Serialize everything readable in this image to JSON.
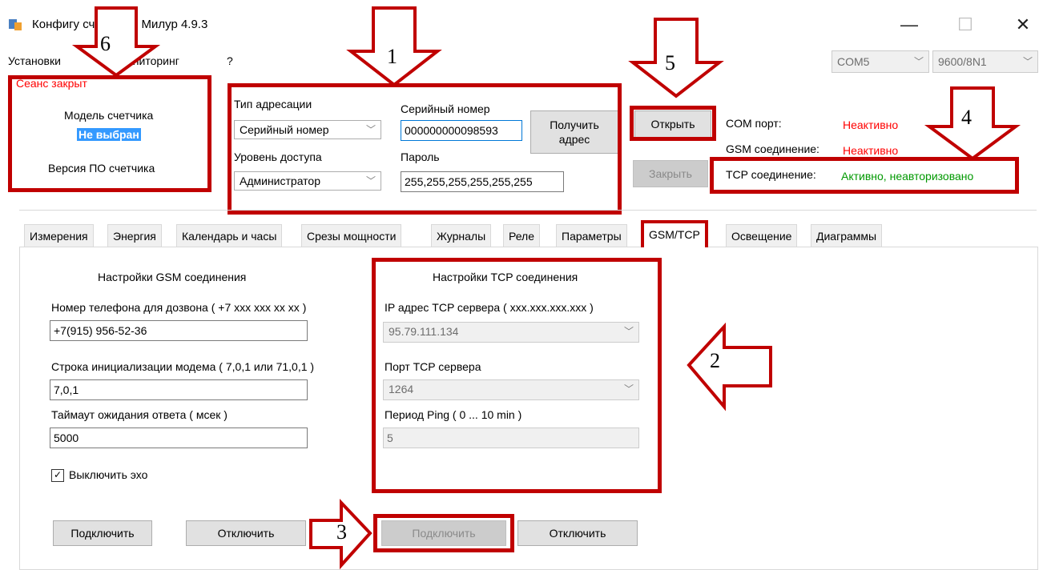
{
  "window": {
    "title": "Конфигуратор счетчиков Милур 4.9.3",
    "title_visible": "Конфигу  счетчиков Милур 4.9.3",
    "minimize": "—",
    "maximize": "☐",
    "close": "✕"
  },
  "menu": {
    "items": [
      "Установки",
      "Мониторинг",
      "?"
    ],
    "visible_1": "Установки",
    "visible_2": "ониторинг",
    "visible_3": "?"
  },
  "port": {
    "com": "COM5",
    "baud": "9600/8N1"
  },
  "session": {
    "status": "Сеанс закрыт",
    "model_label": "Модель счетчика",
    "model_value": "Не выбран",
    "firmware_label": "Версия ПО счетчика"
  },
  "addressing": {
    "type_label": "Тип адресации",
    "type_value": "Серийный номер",
    "access_label": "Уровень доступа",
    "access_value": "Администратор",
    "serial_label": "Серийный номер",
    "serial_value": "000000000098593",
    "password_label": "Пароль",
    "password_value": "255,255,255,255,255,255",
    "get_address_button": "Получить адрес"
  },
  "connection": {
    "open_button": "Открыть",
    "close_button": "Закрыть",
    "com_label": "COM порт:",
    "com_status": "Неактивно",
    "gsm_label": "GSM соединение:",
    "gsm_status": "Неактивно",
    "tcp_label": "TCP соединение:",
    "tcp_status": "Активно, неавторизовано"
  },
  "tabs": [
    "Измерения",
    "Энергия",
    "Календарь и часы",
    "Срезы мощности",
    "Журналы",
    "Реле",
    "Параметры",
    "GSM/TCP",
    "Освещение",
    "Диаграммы"
  ],
  "active_tab": "GSM/TCP",
  "gsm": {
    "heading": "Настройки GSM соединения",
    "phone_label": "Номер телефона для дозвона ( +7 xxx xxx xx xx )",
    "phone_value": "+7(915) 956-52-36",
    "init_label": "Строка инициализации модема ( 7,0,1 или 71,0,1 )",
    "init_value": "7,0,1",
    "timeout_label": "Таймаут ожидания ответа ( мсек )",
    "timeout_value": "5000",
    "echo_label": "Выключить эхо",
    "echo_checked": true,
    "connect_button": "Подключить",
    "disconnect_button": "Отключить"
  },
  "tcp": {
    "heading": "Настройки TCP соединения",
    "ip_label": "IP адрес TCP сервера ( xxx.xxx.xxx.xxx )",
    "ip_value": "95.79.111.134",
    "port_label": "Порт TCP сервера",
    "port_value": "1264",
    "ping_label": "Период Ping ( 0 ... 10 min )",
    "ping_value": "5",
    "connect_button": "Подключить",
    "disconnect_button": "Отключить"
  },
  "annotations": {
    "n1": "1",
    "n2": "2",
    "n3": "3",
    "n4": "4",
    "n5": "5",
    "n6": "6",
    "frame_color": "#c00000"
  }
}
